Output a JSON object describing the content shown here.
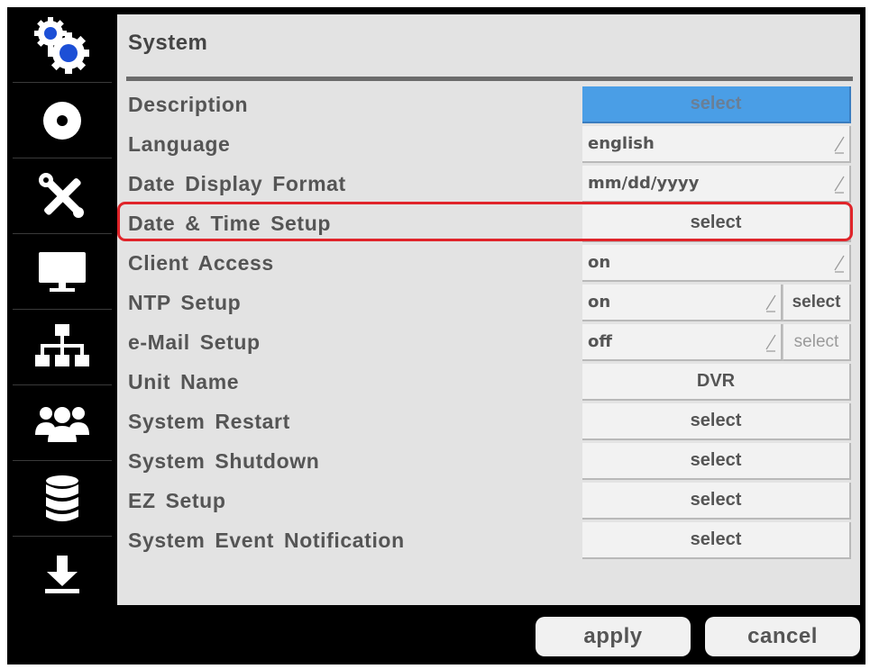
{
  "window": {
    "title": "System"
  },
  "sidebar": {
    "items": [
      {
        "icon": "gears-icon",
        "active": true
      },
      {
        "icon": "disc-icon"
      },
      {
        "icon": "tools-icon"
      },
      {
        "icon": "monitor-icon"
      },
      {
        "icon": "network-icon"
      },
      {
        "icon": "users-icon"
      },
      {
        "icon": "database-icon"
      },
      {
        "icon": "download-icon"
      }
    ]
  },
  "rows": [
    {
      "label": "Description",
      "control": {
        "type": "button",
        "text": "select",
        "highlighted": true
      }
    },
    {
      "label": "Language",
      "control": {
        "type": "dropdown",
        "value": "english"
      }
    },
    {
      "label": "Date Display Format",
      "control": {
        "type": "dropdown",
        "value": "mm/dd/yyyy"
      }
    },
    {
      "label": "Date & Time Setup",
      "control": {
        "type": "button",
        "text": "select"
      }
    },
    {
      "label": "Client Access",
      "control": {
        "type": "dropdown",
        "value": "on"
      }
    },
    {
      "label": "NTP Setup",
      "control": {
        "type": "dropdown",
        "value": "on"
      },
      "side_button": {
        "text": "select",
        "enabled": true
      }
    },
    {
      "label": "e-Mail Setup",
      "control": {
        "type": "dropdown",
        "value": "off"
      },
      "side_button": {
        "text": "select",
        "enabled": false
      }
    },
    {
      "label": "Unit Name",
      "control": {
        "type": "button",
        "text": "DVR"
      }
    },
    {
      "label": "System Restart",
      "control": {
        "type": "button",
        "text": "select"
      }
    },
    {
      "label": "System Shutdown",
      "control": {
        "type": "button",
        "text": "select"
      }
    },
    {
      "label": "EZ Setup",
      "control": {
        "type": "button",
        "text": "select"
      }
    },
    {
      "label": "System Event Notification",
      "control": {
        "type": "button",
        "text": "select"
      }
    }
  ],
  "footer": {
    "apply_label": "apply",
    "cancel_label": "cancel"
  },
  "colors": {
    "accent": "#4a9ee6",
    "highlight_outline": "#e0242a",
    "panel_bg": "#e3e3e3"
  }
}
